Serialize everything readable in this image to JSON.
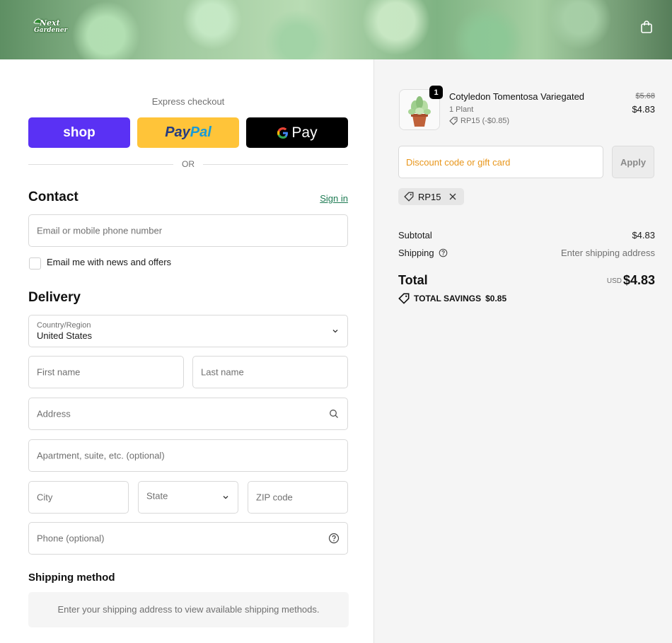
{
  "header": {
    "logo_line1": "Next",
    "logo_line2": "Gardener",
    "cart_icon": "shopping-bag-icon"
  },
  "express": {
    "label": "Express checkout",
    "shop_label": "shop",
    "paypal_label": "PayPal",
    "gpay_label": "Pay",
    "or_text": "OR"
  },
  "contact": {
    "heading": "Contact",
    "signin_link": "Sign in",
    "email_placeholder": "Email or mobile phone number",
    "newsletter_label": "Email me with news and offers",
    "newsletter_checked": false
  },
  "delivery": {
    "heading": "Delivery",
    "country_label": "Country/Region",
    "country_value": "United States",
    "first_name_placeholder": "First name",
    "last_name_placeholder": "Last name",
    "address_placeholder": "Address",
    "apartment_placeholder": "Apartment, suite, etc. (optional)",
    "city_placeholder": "City",
    "state_placeholder": "State",
    "zip_placeholder": "ZIP code",
    "phone_placeholder": "Phone (optional)"
  },
  "shipping_method": {
    "heading": "Shipping method",
    "note": "Enter your shipping address to view available shipping methods."
  },
  "order": {
    "item": {
      "name": "Cotyledon Tomentosa Variegated",
      "variant": "1 Plant",
      "discount": "RP15 (-$0.85)",
      "quantity": "1",
      "original_price": "$5.68",
      "price": "$4.83"
    },
    "discount_placeholder": "Discount code or gift card",
    "apply_label": "Apply",
    "applied_code": "RP15",
    "subtotal_label": "Subtotal",
    "subtotal_value": "$4.83",
    "shipping_label": "Shipping",
    "shipping_value": "Enter shipping address",
    "total_label": "Total",
    "currency": "USD",
    "total_value": "$4.83",
    "savings_label": "TOTAL SAVINGS",
    "savings_value": "$0.85"
  },
  "colors": {
    "shop_purple": "#5a31f4",
    "paypal_yellow": "#ffc439",
    "link_green": "#1c7a52",
    "discount_orange": "#e8961b"
  }
}
